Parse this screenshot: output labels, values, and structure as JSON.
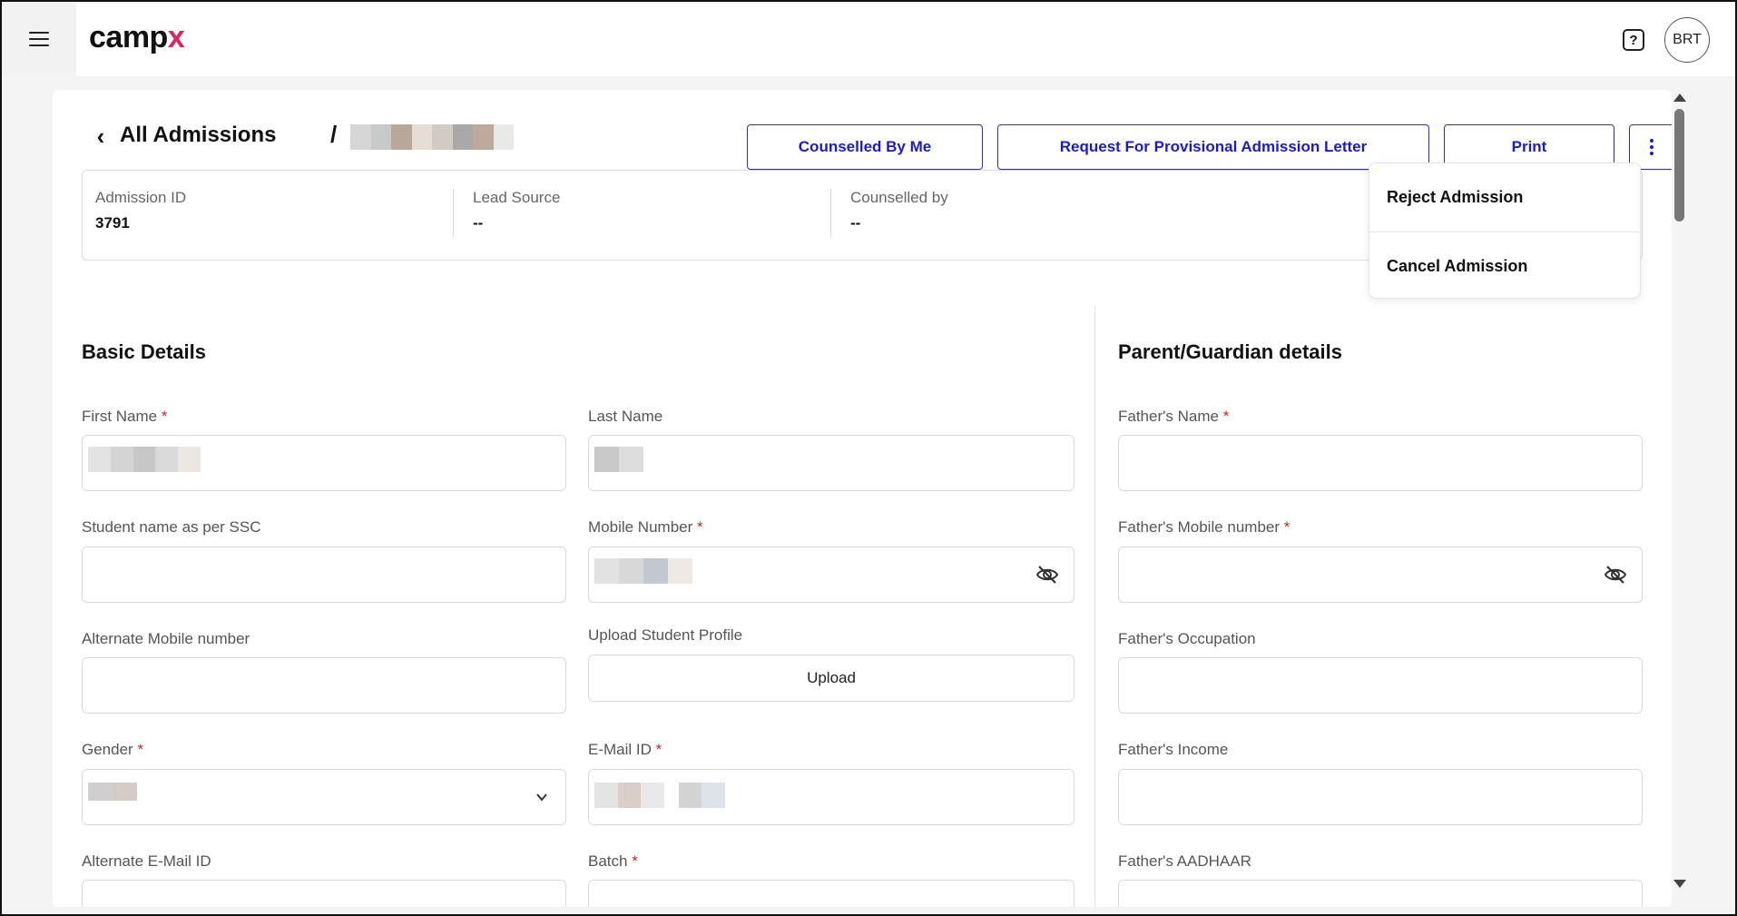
{
  "app": {
    "logo_text": "camp",
    "logo_accent": "x",
    "accent_color": "#e0245e",
    "primary_color": "#1a1ad6"
  },
  "topbar": {
    "avatar_initials": "BRT",
    "help_symbol": "?"
  },
  "header": {
    "breadcrumb": "All Admissions",
    "separator": "/",
    "buttons": {
      "counselled": "Counselled By Me",
      "request": "Request For Provisional Admission Letter",
      "print": "Print"
    }
  },
  "info": [
    {
      "label": "Admission ID",
      "value": "3791"
    },
    {
      "label": "Lead Source",
      "value": "--"
    },
    {
      "label": "Counselled by",
      "value": "--"
    }
  ],
  "dropdown": {
    "items": [
      "Reject Admission",
      "Cancel Admission"
    ]
  },
  "basic": {
    "title": "Basic Details",
    "first_name": "First Name",
    "last_name": "Last Name",
    "ssc_name": "Student name as per SSC",
    "mobile": "Mobile Number",
    "alt_mobile": "Alternate Mobile number",
    "upload_profile": "Upload Student Profile",
    "upload_btn": "Upload",
    "gender": "Gender",
    "email": "E-Mail ID",
    "alt_email": "Alternate E-Mail ID",
    "batch": "Batch",
    "required_mark": "*"
  },
  "parent": {
    "title": "Parent/Guardian details",
    "father_name": "Father's Name",
    "father_mobile": "Father's Mobile number",
    "father_occupation": "Father's Occupation",
    "father_income": "Father's Income",
    "father_aadhaar": "Father's AADHAAR",
    "required_mark": "*"
  }
}
